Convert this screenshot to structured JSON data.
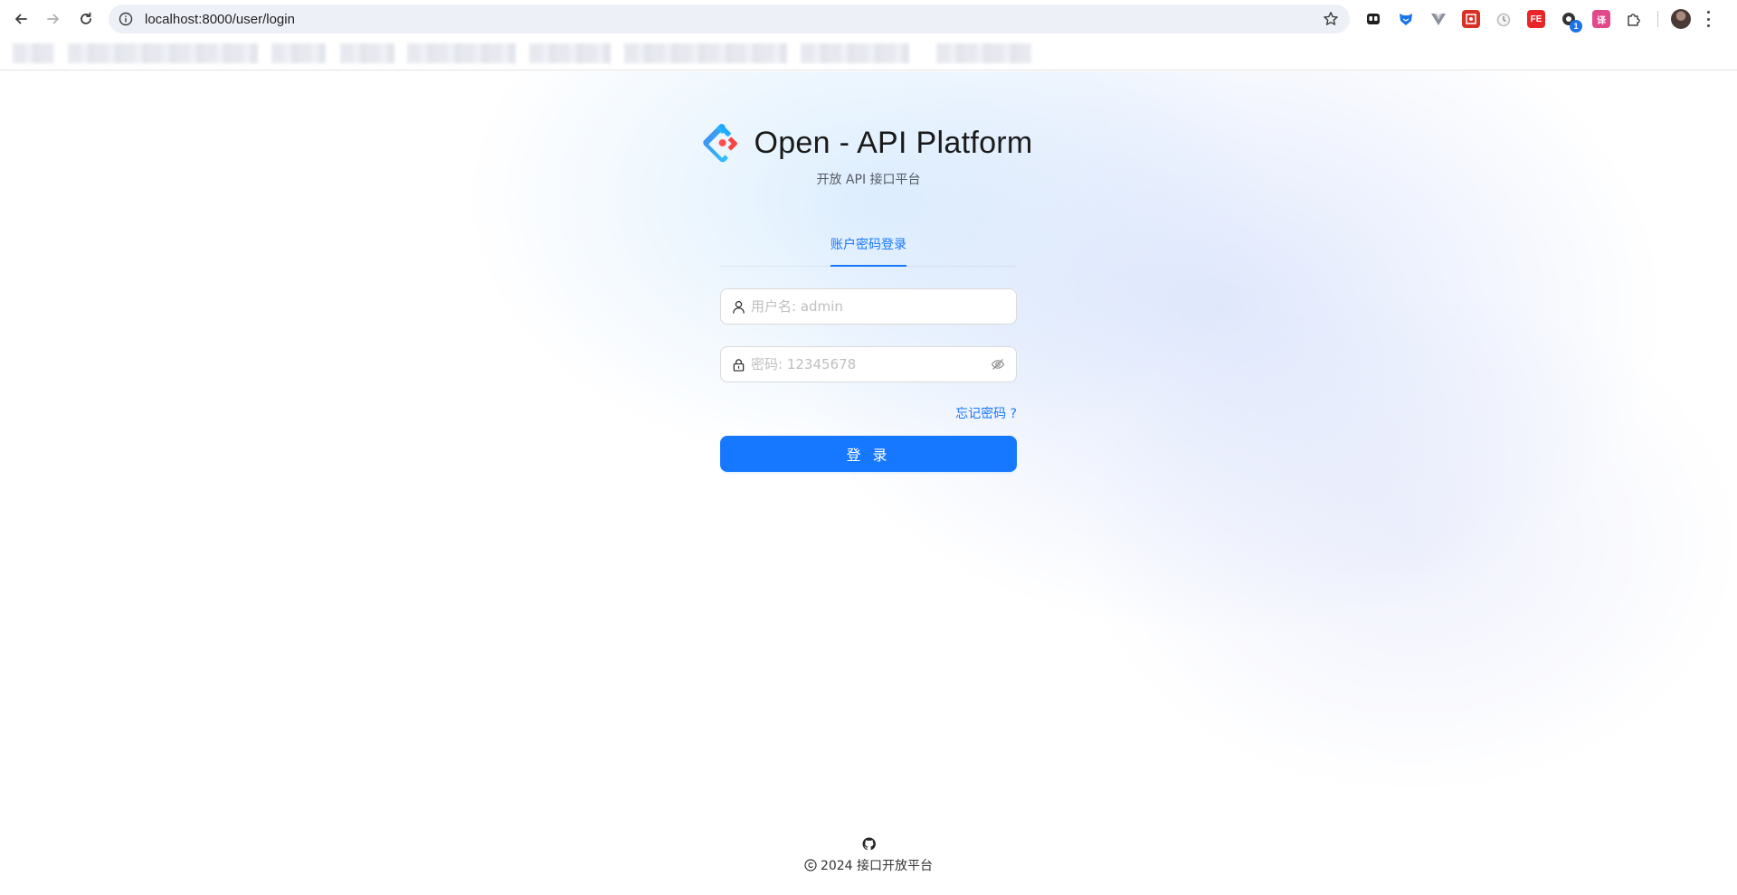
{
  "browser": {
    "url": "localhost:8000/user/login",
    "extensions": [
      {
        "icon": "tab-manager-extension-icon",
        "color": "#1f1f1f"
      },
      {
        "icon": "fox-extension-icon",
        "color": "#1a73e8"
      },
      {
        "icon": "vue-devtools-extension-icon",
        "color": "#8a8f99"
      },
      {
        "icon": "screenshot-extension-icon",
        "color": "#d93025"
      },
      {
        "icon": "timer-extension-icon",
        "color": "#c7c7c7"
      },
      {
        "icon": "fe-helper-extension-icon",
        "color": "#e8262a",
        "text": "FE"
      },
      {
        "icon": "proxy-extension-icon",
        "color": "#333333",
        "badge": "1"
      },
      {
        "icon": "translate-extension-icon",
        "color": "#e2488a",
        "text": "译"
      },
      {
        "icon": "extensions-puzzle-icon",
        "color": "#444444"
      }
    ]
  },
  "login": {
    "title": "Open - API Platform",
    "subtitle": "开放 API 接口平台",
    "tab_label": "账户密码登录",
    "username_placeholder": "用户名: admin",
    "password_placeholder": "密码: 12345678",
    "forgot_label": "忘记密码 ?",
    "submit_label": "登 录",
    "primary_color": "#1677ff"
  },
  "footer": {
    "copyright": "2024 接口开放平台"
  }
}
